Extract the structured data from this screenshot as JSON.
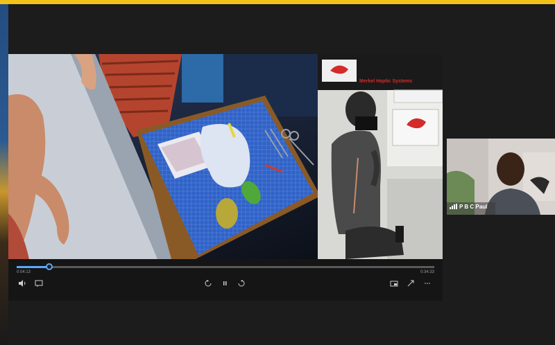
{
  "video": {
    "time_elapsed": "0:04:13",
    "time_total": "0:34:33",
    "progress": 0.08,
    "inset_brand": "Merkel Haptic Systems"
  },
  "participant": {
    "name": "P B C Paul"
  },
  "colors": {
    "frame_border": "#f3c21a",
    "progress_accent": "#5aa9ff",
    "brand_red": "#d42a2a"
  }
}
